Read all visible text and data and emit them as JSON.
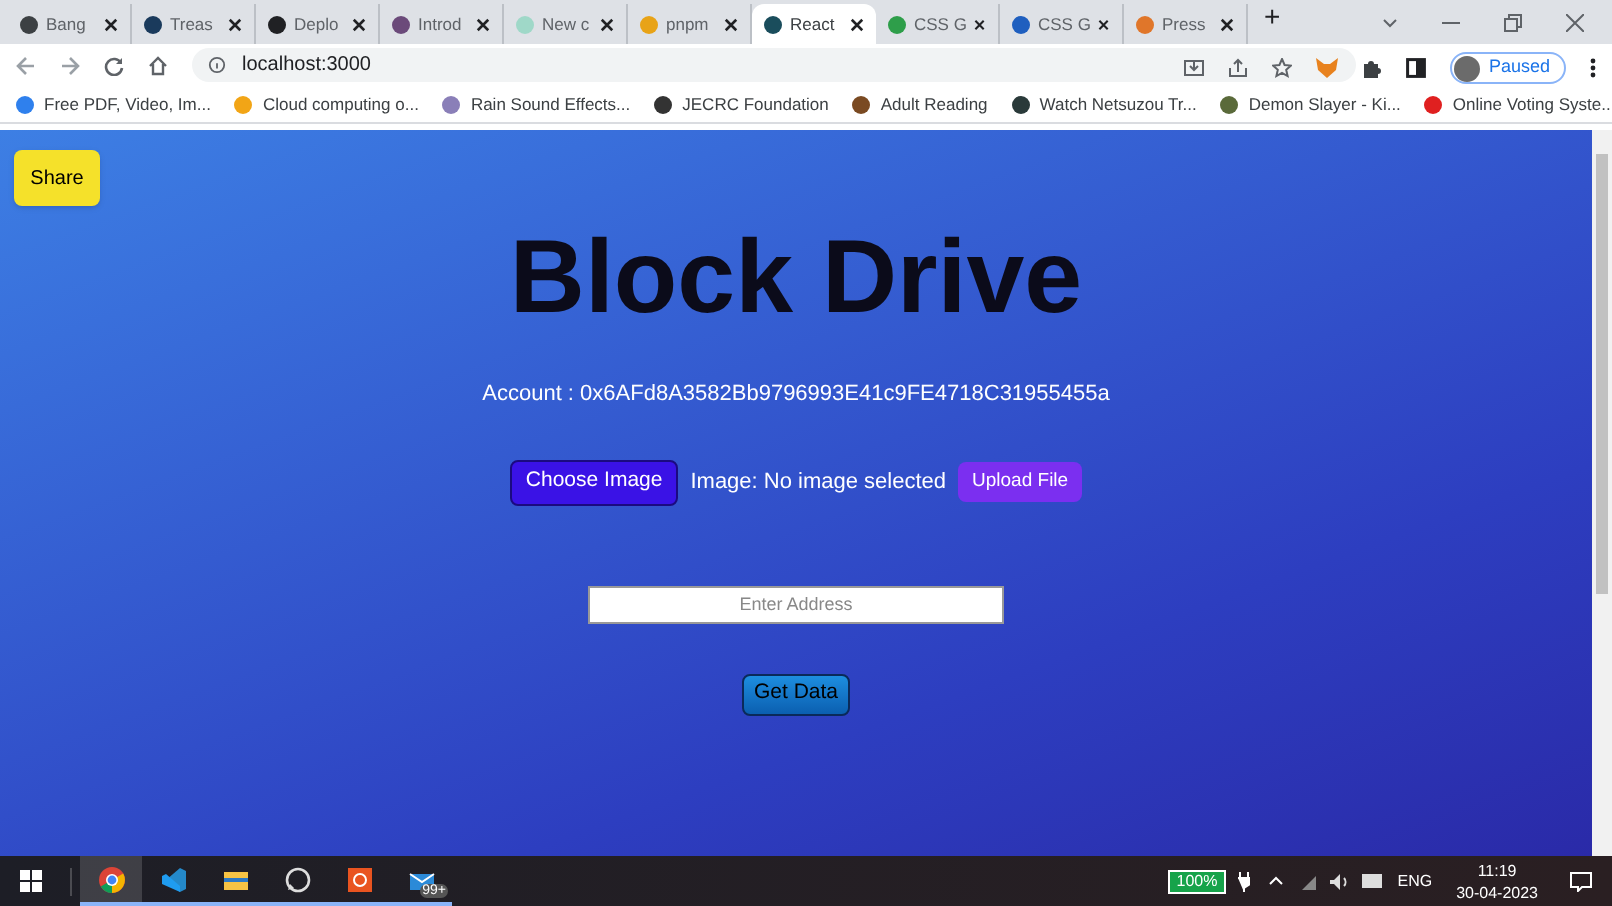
{
  "tabs": [
    {
      "title": "Bang",
      "selected": false,
      "color": "#3c4043"
    },
    {
      "title": "Treas",
      "selected": false,
      "color": "#1a3a5c"
    },
    {
      "title": "Deplo",
      "selected": false,
      "color": "#202124"
    },
    {
      "title": "Introd",
      "selected": false,
      "color": "#6b4a7a"
    },
    {
      "title": "New c",
      "selected": false,
      "color": "#9fd8c8"
    },
    {
      "title": "pnpm",
      "selected": false,
      "color": "#e8a317"
    },
    {
      "title": "React",
      "selected": true,
      "color": "#1a4d5c"
    },
    {
      "title": "CSS G",
      "selected": false,
      "color": "#2e9e4a"
    },
    {
      "title": "CSS G",
      "selected": false,
      "color": "#1f5fbf"
    },
    {
      "title": "Press",
      "selected": false,
      "color": "#e0762a"
    }
  ],
  "new_tab": "+",
  "address": "localhost:3000",
  "profile": {
    "label": "Paused"
  },
  "bookmarks": [
    {
      "label": "Free PDF, Video, Im...",
      "color": "#2f80ed"
    },
    {
      "label": "Cloud computing o...",
      "color": "#f2a516"
    },
    {
      "label": "Rain Sound Effects...",
      "color": "#8a7fb8"
    },
    {
      "label": "JECRC Foundation",
      "color": "#333333"
    },
    {
      "label": "Adult Reading",
      "color": "#7a4a22"
    },
    {
      "label": "Watch Netsuzou Tr...",
      "color": "#2a3a3a"
    },
    {
      "label": "Demon Slayer - Ki...",
      "color": "#5a6a3a"
    },
    {
      "label": "Online Voting Syste...",
      "color": "#e02020"
    }
  ],
  "page": {
    "share_button": "Share",
    "title": "Block Drive",
    "account": "Account : 0x6AFd8A3582Bb9796993E41c9FE4718C31955455a",
    "choose_button": "Choose Image",
    "image_status": "Image: No image selected",
    "upload_button": "Upload File",
    "address_field": {
      "placeholder": "Enter Address"
    },
    "get_data_button": "Get Data"
  },
  "taskbar": {
    "apps": [
      {
        "kind": "chrome",
        "selected": true
      },
      {
        "kind": "vscode",
        "selected": false
      },
      {
        "kind": "files",
        "selected": false
      },
      {
        "kind": "whatsapp",
        "selected": false
      },
      {
        "kind": "ubuntu",
        "selected": false
      },
      {
        "kind": "mail",
        "selected": false,
        "badge": "99+"
      }
    ],
    "battery": "100%",
    "language": "ENG",
    "time": "11:19",
    "date": "30-04-2023"
  }
}
